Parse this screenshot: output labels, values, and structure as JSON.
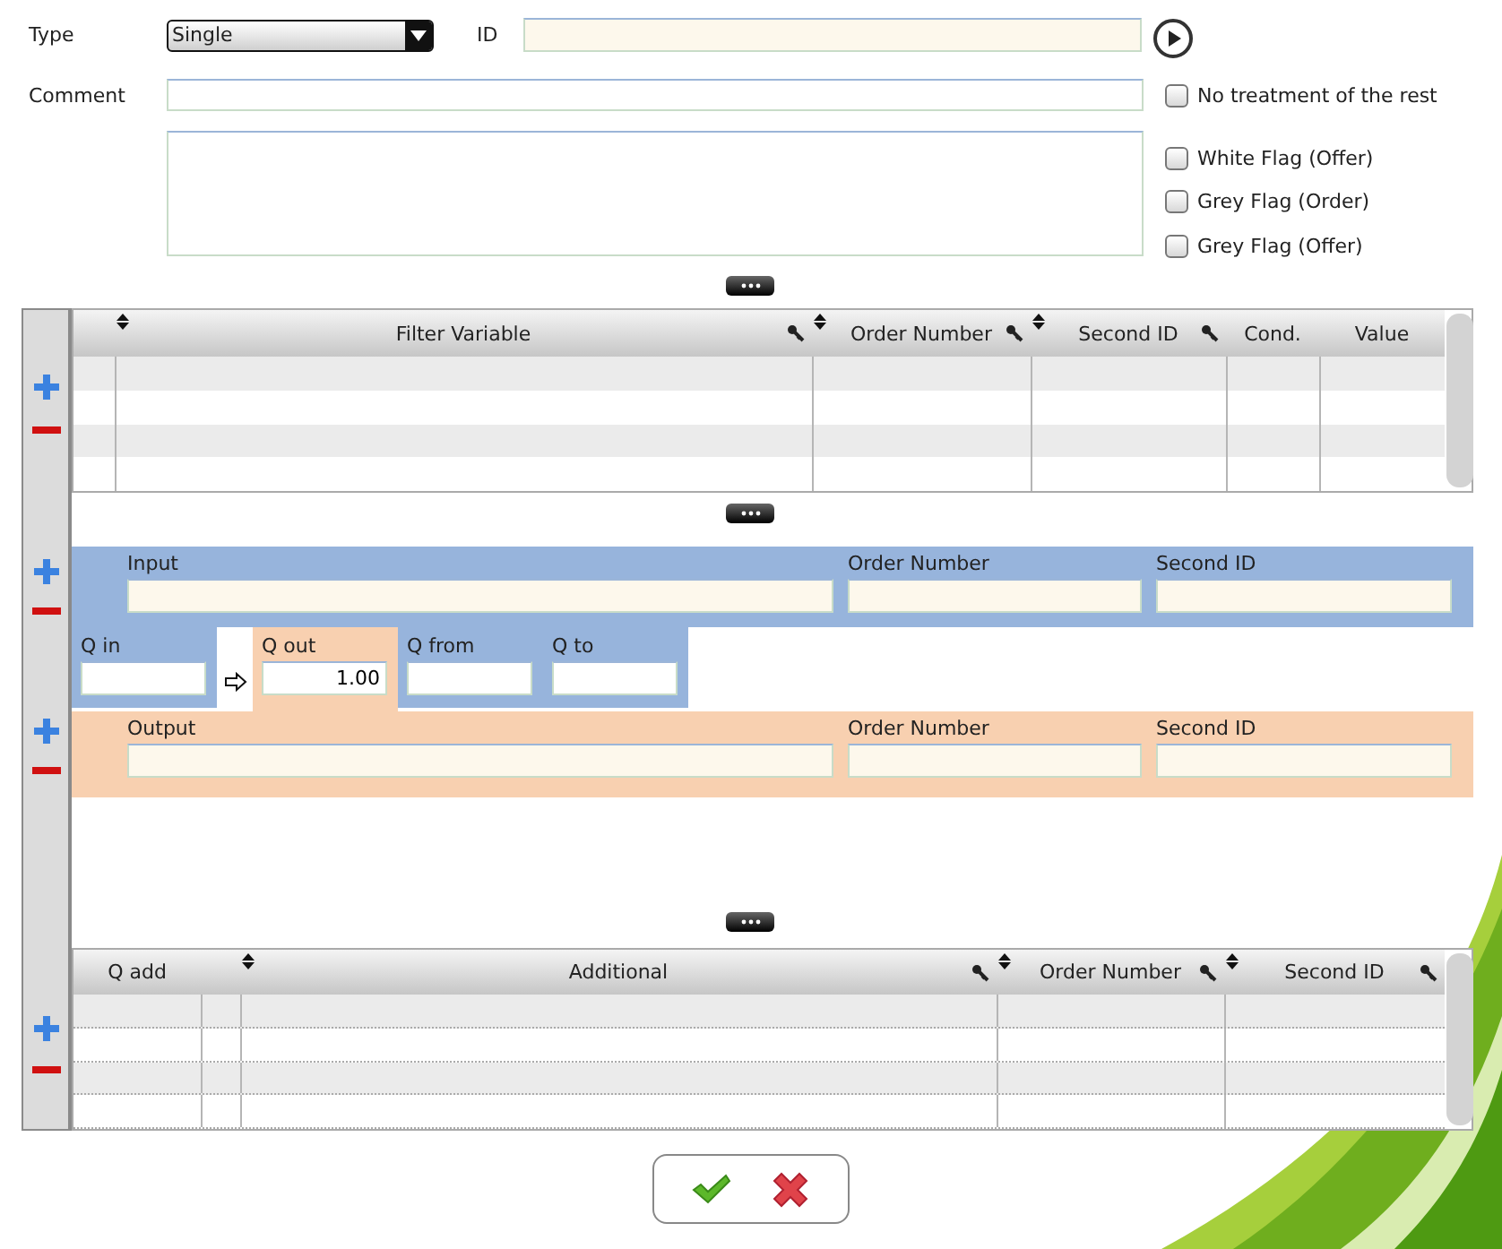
{
  "form": {
    "type": {
      "label": "Type",
      "value": "Single"
    },
    "id": {
      "label": "ID"
    },
    "comment": {
      "label": "Comment"
    }
  },
  "options": [
    {
      "label": "No treatment of the rest",
      "checked": false
    },
    {
      "label": "White Flag (Offer)",
      "checked": false
    },
    {
      "label": "Grey Flag (Order)",
      "checked": false
    },
    {
      "label": "Grey Flag (Offer)",
      "checked": false
    }
  ],
  "filter_table": {
    "columns": [
      {
        "label": "Filter Variable",
        "sortable": true,
        "searchable": true
      },
      {
        "label": "Order Number",
        "sortable": true,
        "searchable": true
      },
      {
        "label": "Second ID",
        "sortable": true,
        "searchable": true
      },
      {
        "label": "Cond.",
        "sortable": false,
        "searchable": false
      },
      {
        "label": "Value",
        "sortable": false,
        "searchable": false
      }
    ]
  },
  "input": {
    "fields": [
      {
        "label": "Input"
      },
      {
        "label": "Order Number"
      },
      {
        "label": "Second ID"
      }
    ]
  },
  "quantities": [
    {
      "label": "Q in",
      "kind": "input"
    },
    {
      "label": "Q out",
      "kind": "output",
      "value": "1.00"
    },
    {
      "label": "Q from",
      "kind": "input"
    },
    {
      "label": "Q to",
      "kind": "input"
    }
  ],
  "output": {
    "fields": [
      {
        "label": "Output"
      },
      {
        "label": "Order Number"
      },
      {
        "label": "Second ID"
      }
    ]
  },
  "additional_table": {
    "columns": [
      {
        "label": "Q add",
        "sortable": false,
        "searchable": false
      },
      {
        "label": "Additional",
        "sortable": true,
        "searchable": true
      },
      {
        "label": "Order Number",
        "sortable": true,
        "searchable": true
      },
      {
        "label": "Second ID",
        "sortable": true,
        "searchable": true
      }
    ]
  }
}
